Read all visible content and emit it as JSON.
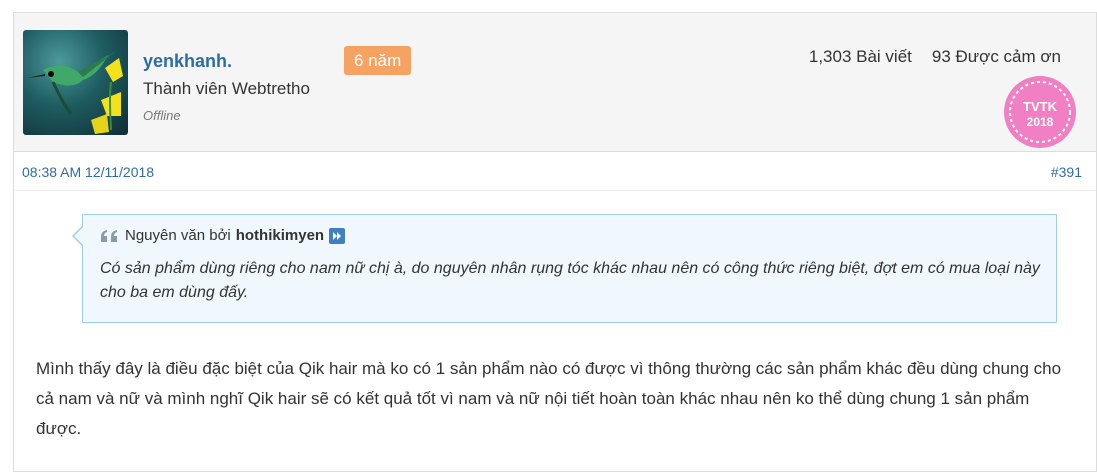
{
  "user": {
    "name": "yenkhanh.",
    "years_badge": "6 năm",
    "title": "Thành viên Webtretho",
    "status": "Offline"
  },
  "stats": {
    "posts": "1,303 Bài viết",
    "thanks": "93 Được cảm ơn"
  },
  "badge": {
    "line1": "TVTK",
    "line2": "2018",
    "color": "#f07fc3"
  },
  "post": {
    "timestamp": "08:38 AM 12/11/2018",
    "number": "#391",
    "body": "Mình thấy đây là điều đặc biệt của Qik hair mà ko có 1 sản phẩm nào có được vì thông thường các sản phẩm khác đều dùng chung cho cả nam và nữ và mình nghĩ Qik hair sẽ có kết quả tốt vì nam và nữ nội tiết hoàn toàn khác nhau nên ko thể dùng chung 1 sản phẩm được."
  },
  "quote": {
    "prefix": "Nguyên văn bởi",
    "author": "hothikimyen",
    "text": "Có sản phẩm dùng riêng cho nam nữ chị à, do nguyên nhân rụng tóc khác nhau nên có công thức riêng biệt, đợt em có mua loại này cho ba em dùng đấy."
  },
  "colors": {
    "link": "#2e6da4",
    "badge_orange": "#f5a263",
    "quote_bg": "#f0f8fd",
    "quote_border": "#9ccde9"
  },
  "icons": {
    "quote": "quote-icon",
    "jump": "jump-to-post-icon"
  }
}
